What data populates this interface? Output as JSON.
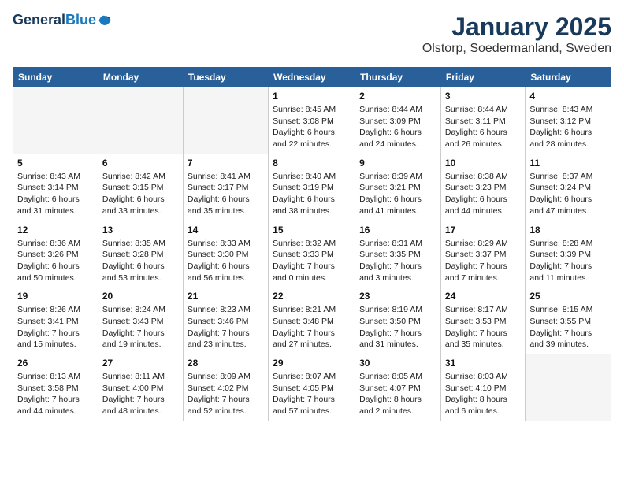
{
  "header": {
    "logo_line1": "General",
    "logo_line2": "Blue",
    "month_title": "January 2025",
    "location": "Olstorp, Soedermanland, Sweden"
  },
  "weekdays": [
    "Sunday",
    "Monday",
    "Tuesday",
    "Wednesday",
    "Thursday",
    "Friday",
    "Saturday"
  ],
  "weeks": [
    [
      {
        "day": "",
        "text": ""
      },
      {
        "day": "",
        "text": ""
      },
      {
        "day": "",
        "text": ""
      },
      {
        "day": "1",
        "text": "Sunrise: 8:45 AM\nSunset: 3:08 PM\nDaylight: 6 hours\nand 22 minutes."
      },
      {
        "day": "2",
        "text": "Sunrise: 8:44 AM\nSunset: 3:09 PM\nDaylight: 6 hours\nand 24 minutes."
      },
      {
        "day": "3",
        "text": "Sunrise: 8:44 AM\nSunset: 3:11 PM\nDaylight: 6 hours\nand 26 minutes."
      },
      {
        "day": "4",
        "text": "Sunrise: 8:43 AM\nSunset: 3:12 PM\nDaylight: 6 hours\nand 28 minutes."
      }
    ],
    [
      {
        "day": "5",
        "text": "Sunrise: 8:43 AM\nSunset: 3:14 PM\nDaylight: 6 hours\nand 31 minutes."
      },
      {
        "day": "6",
        "text": "Sunrise: 8:42 AM\nSunset: 3:15 PM\nDaylight: 6 hours\nand 33 minutes."
      },
      {
        "day": "7",
        "text": "Sunrise: 8:41 AM\nSunset: 3:17 PM\nDaylight: 6 hours\nand 35 minutes."
      },
      {
        "day": "8",
        "text": "Sunrise: 8:40 AM\nSunset: 3:19 PM\nDaylight: 6 hours\nand 38 minutes."
      },
      {
        "day": "9",
        "text": "Sunrise: 8:39 AM\nSunset: 3:21 PM\nDaylight: 6 hours\nand 41 minutes."
      },
      {
        "day": "10",
        "text": "Sunrise: 8:38 AM\nSunset: 3:23 PM\nDaylight: 6 hours\nand 44 minutes."
      },
      {
        "day": "11",
        "text": "Sunrise: 8:37 AM\nSunset: 3:24 PM\nDaylight: 6 hours\nand 47 minutes."
      }
    ],
    [
      {
        "day": "12",
        "text": "Sunrise: 8:36 AM\nSunset: 3:26 PM\nDaylight: 6 hours\nand 50 minutes."
      },
      {
        "day": "13",
        "text": "Sunrise: 8:35 AM\nSunset: 3:28 PM\nDaylight: 6 hours\nand 53 minutes."
      },
      {
        "day": "14",
        "text": "Sunrise: 8:33 AM\nSunset: 3:30 PM\nDaylight: 6 hours\nand 56 minutes."
      },
      {
        "day": "15",
        "text": "Sunrise: 8:32 AM\nSunset: 3:33 PM\nDaylight: 7 hours\nand 0 minutes."
      },
      {
        "day": "16",
        "text": "Sunrise: 8:31 AM\nSunset: 3:35 PM\nDaylight: 7 hours\nand 3 minutes."
      },
      {
        "day": "17",
        "text": "Sunrise: 8:29 AM\nSunset: 3:37 PM\nDaylight: 7 hours\nand 7 minutes."
      },
      {
        "day": "18",
        "text": "Sunrise: 8:28 AM\nSunset: 3:39 PM\nDaylight: 7 hours\nand 11 minutes."
      }
    ],
    [
      {
        "day": "19",
        "text": "Sunrise: 8:26 AM\nSunset: 3:41 PM\nDaylight: 7 hours\nand 15 minutes."
      },
      {
        "day": "20",
        "text": "Sunrise: 8:24 AM\nSunset: 3:43 PM\nDaylight: 7 hours\nand 19 minutes."
      },
      {
        "day": "21",
        "text": "Sunrise: 8:23 AM\nSunset: 3:46 PM\nDaylight: 7 hours\nand 23 minutes."
      },
      {
        "day": "22",
        "text": "Sunrise: 8:21 AM\nSunset: 3:48 PM\nDaylight: 7 hours\nand 27 minutes."
      },
      {
        "day": "23",
        "text": "Sunrise: 8:19 AM\nSunset: 3:50 PM\nDaylight: 7 hours\nand 31 minutes."
      },
      {
        "day": "24",
        "text": "Sunrise: 8:17 AM\nSunset: 3:53 PM\nDaylight: 7 hours\nand 35 minutes."
      },
      {
        "day": "25",
        "text": "Sunrise: 8:15 AM\nSunset: 3:55 PM\nDaylight: 7 hours\nand 39 minutes."
      }
    ],
    [
      {
        "day": "26",
        "text": "Sunrise: 8:13 AM\nSunset: 3:58 PM\nDaylight: 7 hours\nand 44 minutes."
      },
      {
        "day": "27",
        "text": "Sunrise: 8:11 AM\nSunset: 4:00 PM\nDaylight: 7 hours\nand 48 minutes."
      },
      {
        "day": "28",
        "text": "Sunrise: 8:09 AM\nSunset: 4:02 PM\nDaylight: 7 hours\nand 52 minutes."
      },
      {
        "day": "29",
        "text": "Sunrise: 8:07 AM\nSunset: 4:05 PM\nDaylight: 7 hours\nand 57 minutes."
      },
      {
        "day": "30",
        "text": "Sunrise: 8:05 AM\nSunset: 4:07 PM\nDaylight: 8 hours\nand 2 minutes."
      },
      {
        "day": "31",
        "text": "Sunrise: 8:03 AM\nSunset: 4:10 PM\nDaylight: 8 hours\nand 6 minutes."
      },
      {
        "day": "",
        "text": ""
      }
    ]
  ]
}
